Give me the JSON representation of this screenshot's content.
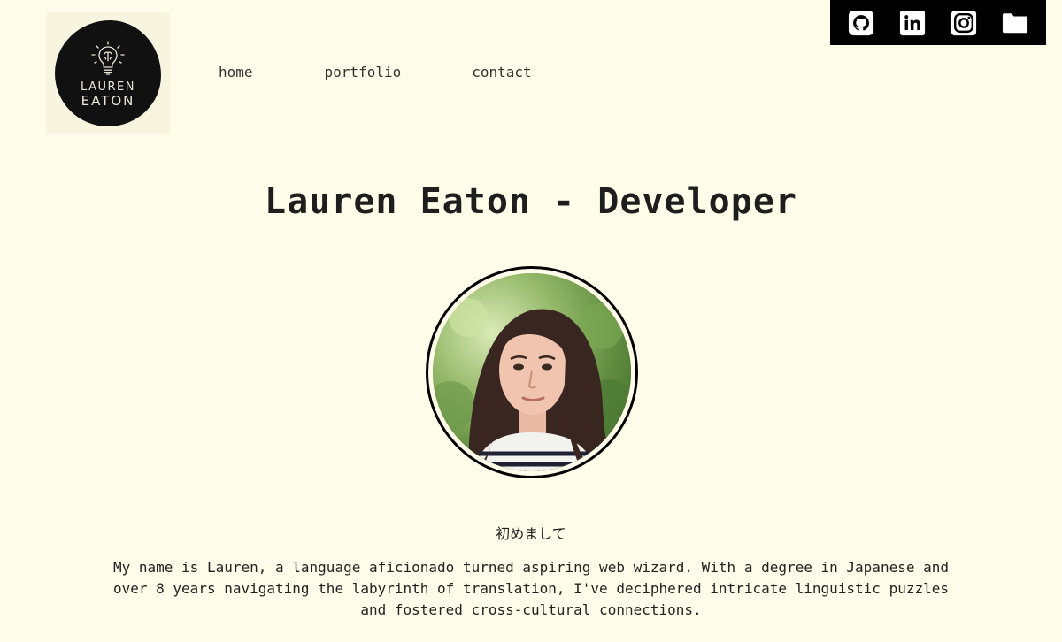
{
  "social": {
    "items": [
      {
        "name": "github",
        "icon": "github-icon"
      },
      {
        "name": "linkedin",
        "icon": "linkedin-icon"
      },
      {
        "name": "instagram",
        "icon": "instagram-icon"
      },
      {
        "name": "resume",
        "icon": "folder-icon"
      }
    ]
  },
  "logo": {
    "line1": "LAUREN",
    "line2": "EATON"
  },
  "nav": {
    "home": "home",
    "portfolio": "portfolio",
    "contact": "contact"
  },
  "hero": {
    "title": "Lauren Eaton - Developer"
  },
  "about": {
    "greeting": "初めまして",
    "bio": "My name is Lauren, a language aficionado turned aspiring web wizard. With a degree in Japanese and over 8 years navigating the labyrinth of translation, I've deciphered intricate linguistic puzzles and fostered cross-cultural connections."
  },
  "colors": {
    "background": "#fffde9",
    "social_bar": "#000000",
    "text": "#1e1e1e"
  }
}
